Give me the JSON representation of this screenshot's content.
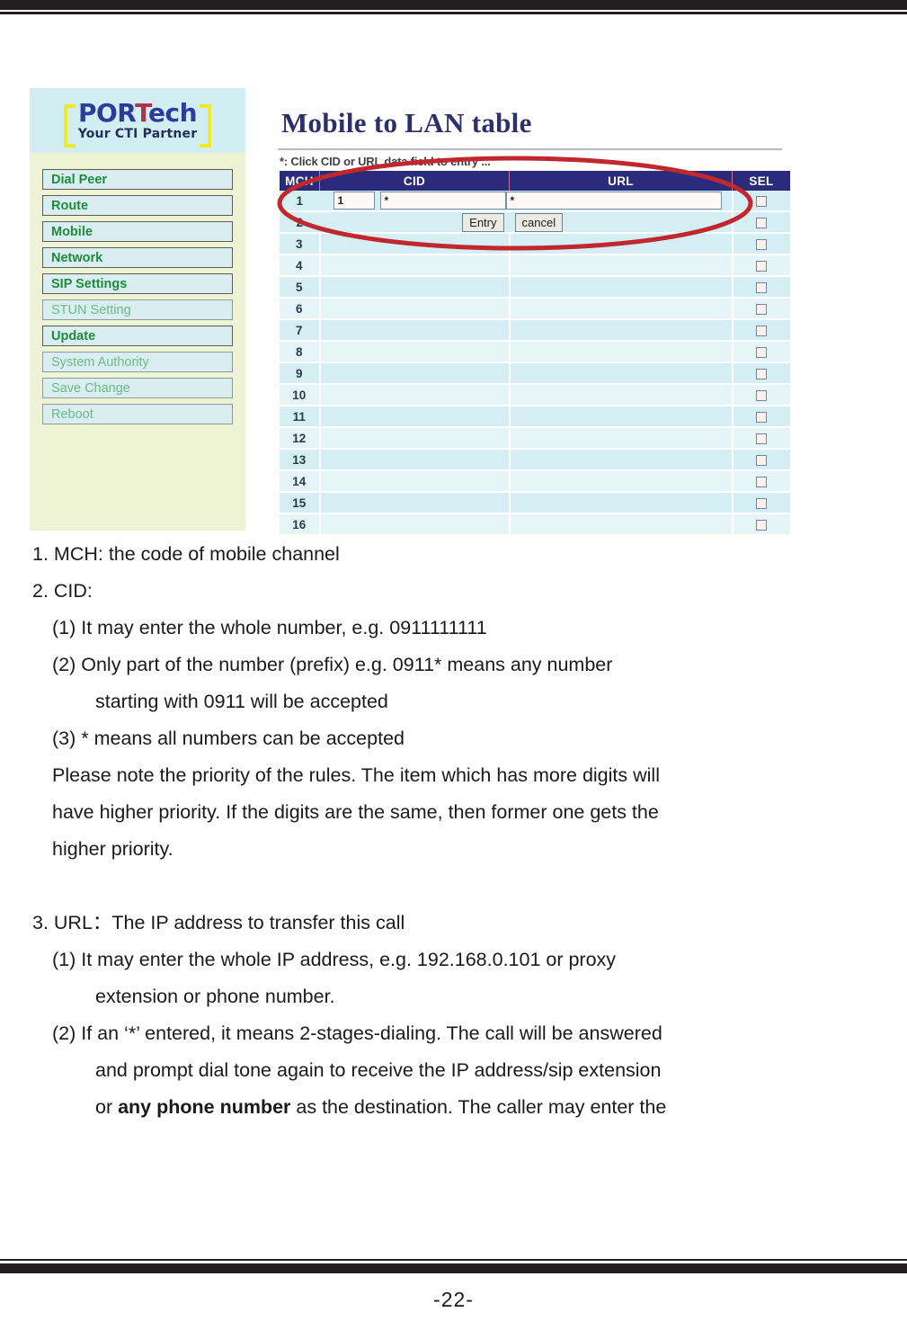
{
  "document": {
    "page_number": "-22-"
  },
  "figure": {
    "logo": {
      "name_prefix": "POR",
      "name_t": "T",
      "name_suffix": "ech",
      "tagline": "Your CTI Partner"
    },
    "nav": {
      "items": [
        {
          "label": "Dial Peer",
          "style": "bold"
        },
        {
          "label": "Route",
          "style": "bold"
        },
        {
          "label": "Mobile",
          "style": "bold"
        },
        {
          "label": "Network",
          "style": "bold"
        },
        {
          "label": "SIP Settings",
          "style": "bold"
        },
        {
          "label": "STUN Setting",
          "style": "faded"
        },
        {
          "label": "Update",
          "style": "bold"
        },
        {
          "label": "System Authority",
          "style": "faded"
        },
        {
          "label": "Save Change",
          "style": "faded"
        },
        {
          "label": "Reboot",
          "style": "faded"
        }
      ]
    },
    "content": {
      "title": "Mobile to LAN table",
      "hint": "*: Click CID or URL data field to entry ...",
      "table": {
        "headers": [
          "MCH",
          "CID",
          "URL",
          "SEL"
        ],
        "edit_row": {
          "mch_value": "1",
          "cid_value": "*",
          "url_value": "*",
          "entry_button": "Entry",
          "cancel_button": "cancel"
        },
        "rows": [
          {
            "mch": "1",
            "cid": "",
            "url": ""
          },
          {
            "mch": "2",
            "cid": "",
            "url": ""
          },
          {
            "mch": "3",
            "cid": "",
            "url": ""
          },
          {
            "mch": "4",
            "cid": "",
            "url": ""
          },
          {
            "mch": "5",
            "cid": "",
            "url": ""
          },
          {
            "mch": "6",
            "cid": "",
            "url": ""
          },
          {
            "mch": "7",
            "cid": "",
            "url": ""
          },
          {
            "mch": "8",
            "cid": "",
            "url": ""
          },
          {
            "mch": "9",
            "cid": "",
            "url": ""
          },
          {
            "mch": "10",
            "cid": "",
            "url": ""
          },
          {
            "mch": "11",
            "cid": "",
            "url": ""
          },
          {
            "mch": "12",
            "cid": "",
            "url": ""
          },
          {
            "mch": "13",
            "cid": "",
            "url": ""
          },
          {
            "mch": "14",
            "cid": "",
            "url": ""
          },
          {
            "mch": "15",
            "cid": "",
            "url": ""
          },
          {
            "mch": "16",
            "cid": "",
            "url": ""
          }
        ]
      }
    },
    "annotation_color": "#c0282d"
  },
  "copy": {
    "item1": "1.  MCH:  the code of mobile channel",
    "item2": "2.  CID:",
    "item2_1": "(1) It may enter the whole number, e.g.  0911111111",
    "item2_2": "(2)  Only  part  of  the  number  (prefix)  e.g.  0911*  means  any  number",
    "item2_2_cont": "starting with 0911 will be accepted",
    "item2_3": "(3)  * means all numbers can be accepted",
    "note_line1": "Please note the priority of the rules. The item which has more digits will",
    "note_line2": "have higher priority. If the digits are the same, then former one gets the",
    "note_line3": "higher priority.",
    "item3": "3.  URL：The IP address to transfer this call",
    "item3_1": "(1) It  may  enter  the  whole  IP  address,  e.g.  192.168.0.101  or  proxy",
    "item3_1_cont": "extension or phone number.",
    "item3_2": "(2) If an ‘*’ entered, it means 2-stages-dialing. The call will be answered",
    "item3_2_cont1": "and prompt dial tone again to receive the IP address/sip extension",
    "item3_2_cont2_a": "or ",
    "item3_2_cont2_bold": "any phone number",
    "item3_2_cont2_b": " as the destination. The caller may enter the"
  }
}
